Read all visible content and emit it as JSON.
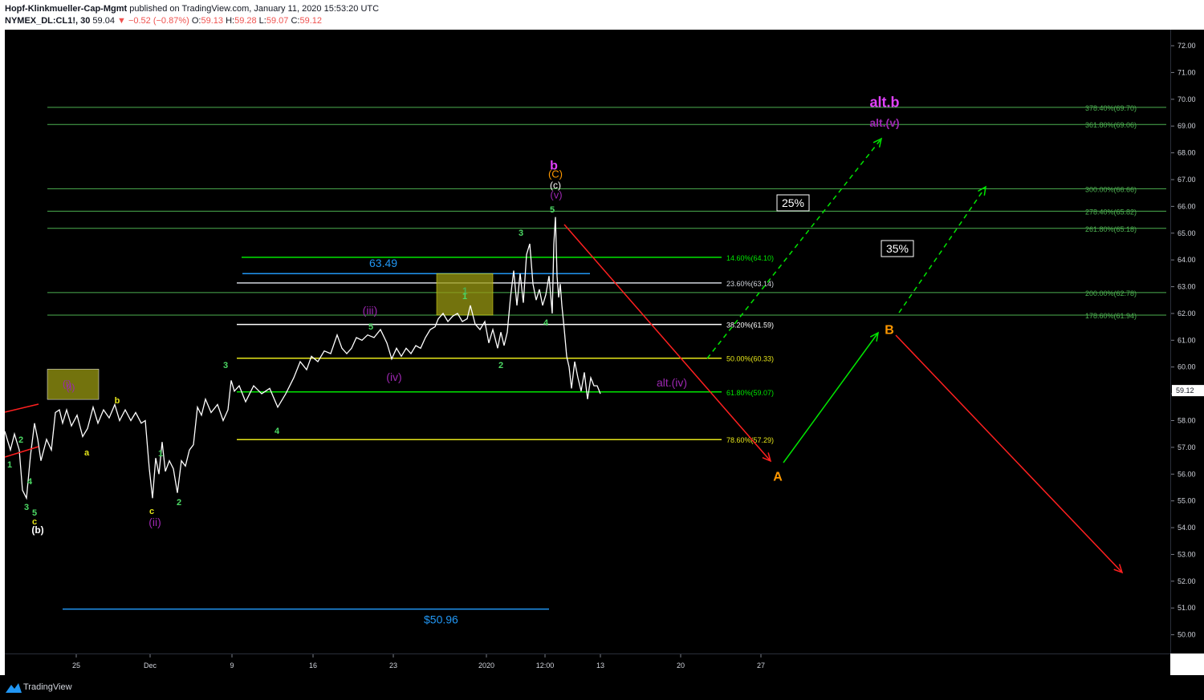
{
  "header": {
    "author": "Hopf-Klinkmueller-Cap-Mgmt",
    "published": "published on TradingView.com, January 11, 2020 15:53:20 UTC",
    "symbol": "NYMEX_DL:CL1!, 30",
    "last": "59.04",
    "change": "▼ −0.52 (−0.87%)",
    "o_label": "O:",
    "o": "59.13",
    "h_label": "H:",
    "h": "59.28",
    "l_label": "L:",
    "l": "59.07",
    "c_label": "C:",
    "c": "59.12"
  },
  "footer": {
    "brand": "TradingView"
  },
  "colors": {
    "up": "#00e600",
    "down": "#ef5350",
    "fib_green": "#4caf50",
    "yellow": "#e5e51a",
    "magenta": "#e040fb",
    "purple": "#9c27b0",
    "orange": "#ff9800",
    "blue": "#2196f3"
  },
  "chart_data": {
    "type": "line",
    "ylim": [
      49.3,
      72.6
    ],
    "price_ticks": [
      "72.00",
      "71.00",
      "70.00",
      "69.00",
      "68.00",
      "67.00",
      "66.00",
      "65.00",
      "64.00",
      "63.00",
      "62.00",
      "61.00",
      "60.00",
      "59.00",
      "58.00",
      "57.00",
      "56.00",
      "55.00",
      "54.00",
      "53.00",
      "52.00",
      "51.00",
      "50.00"
    ],
    "time_ticks": [
      "25",
      "Dec",
      "9",
      "16",
      "23",
      "2020",
      "12:00",
      "13",
      "20",
      "27"
    ],
    "current_price": "59.12",
    "price_series": {
      "name": "CL1!",
      "x": [
        0,
        7,
        12,
        18,
        22,
        27,
        32,
        37,
        41,
        45,
        52,
        58,
        63,
        68,
        72,
        77,
        83,
        90,
        97,
        103,
        110,
        116,
        123,
        130,
        137,
        143,
        150,
        157,
        163,
        170,
        175,
        180,
        184,
        188,
        192,
        196,
        200,
        205,
        210,
        215,
        220,
        225,
        230,
        235,
        240,
        245,
        250,
        257,
        265,
        272,
        278,
        282,
        286,
        292,
        300,
        310,
        320,
        330,
        340,
        350,
        360,
        368,
        376,
        382,
        390,
        398,
        406,
        414,
        420,
        426,
        432,
        438,
        445,
        452,
        460,
        468,
        476,
        482,
        488,
        494,
        500,
        506,
        512,
        518,
        524,
        530,
        536,
        540,
        546,
        552,
        558,
        564,
        570,
        576,
        580,
        586,
        592,
        598,
        603,
        608,
        614,
        618,
        622,
        626,
        630,
        634,
        638,
        642,
        646,
        650,
        654,
        658,
        662,
        666,
        670,
        674,
        678,
        682,
        684,
        686,
        688,
        690,
        692,
        694,
        697,
        700,
        703,
        706,
        710,
        714,
        718,
        722,
        726,
        730,
        734,
        738,
        742
      ],
      "y": [
        57.6,
        56.9,
        57.5,
        56.9,
        55.4,
        55.1,
        56.7,
        57.9,
        57.3,
        56.5,
        57.3,
        56.9,
        58.3,
        58.4,
        57.9,
        58.4,
        57.8,
        58.2,
        57.4,
        57.7,
        58.5,
        57.9,
        58.4,
        58.1,
        58.6,
        58.0,
        58.4,
        58.0,
        58.3,
        57.9,
        58.0,
        56.2,
        55.1,
        56.6,
        56.0,
        57.2,
        56.1,
        56.5,
        56.2,
        55.3,
        56.5,
        56.3,
        56.9,
        57.1,
        58.5,
        58.2,
        58.8,
        58.3,
        58.6,
        58.0,
        58.4,
        59.5,
        59.1,
        59.3,
        58.7,
        59.3,
        59.0,
        59.2,
        58.5,
        59.0,
        59.6,
        60.2,
        59.9,
        60.4,
        60.2,
        60.6,
        60.5,
        61.2,
        60.7,
        60.5,
        60.7,
        61.1,
        61.0,
        61.2,
        61.1,
        61.4,
        60.9,
        60.3,
        60.7,
        60.4,
        60.7,
        60.5,
        60.8,
        60.7,
        61.1,
        61.4,
        61.5,
        61.8,
        62.0,
        61.7,
        61.9,
        62.0,
        61.7,
        61.8,
        62.3,
        61.6,
        61.4,
        61.7,
        60.9,
        61.4,
        60.7,
        61.3,
        60.8,
        61.3,
        62.6,
        63.6,
        62.3,
        63.5,
        62.4,
        64.2,
        64.6,
        63.1,
        62.5,
        62.9,
        62.3,
        62.7,
        63.4,
        62.0,
        64.6,
        65.6,
        63.4,
        62.6,
        63.1,
        62.3,
        61.4,
        60.4,
        60.0,
        59.2,
        60.2,
        59.6,
        59.1,
        59.8,
        58.8,
        59.6,
        59.3,
        59.3,
        59.0
      ]
    },
    "fib_levels": [
      {
        "label": "378.40%(69.70)",
        "value": 69.7
      },
      {
        "label": "361.80%(69.06)",
        "value": 69.06
      },
      {
        "label": "300.00%(66.66)",
        "value": 66.66
      },
      {
        "label": "278.40%(65.82)",
        "value": 65.82
      },
      {
        "label": "261.80%(65.18)",
        "value": 65.18
      },
      {
        "label": "200.00%(62.78)",
        "value": 62.78
      },
      {
        "label": "178.60%(61.94)",
        "value": 61.94
      }
    ],
    "retrace_levels": [
      {
        "label": "14.60%(64.10)",
        "value": 64.1
      },
      {
        "label": "23.60%(63.14)",
        "value": 63.14
      },
      {
        "label": "38.20%(61.59)",
        "value": 61.59
      },
      {
        "label": "50.00%(60.33)",
        "value": 60.33
      },
      {
        "label": "61.80%(59.07)",
        "value": 59.07
      },
      {
        "label": "78.60%(57.29)",
        "value": 57.29
      }
    ],
    "hlines": [
      {
        "label": "63.49",
        "value": 63.49
      },
      {
        "label": "$50.96",
        "value": 50.96
      }
    ],
    "boxes": [
      {
        "label": "1",
        "price_high": 63.49,
        "price_low": 61.94
      },
      {
        "label": "(i)",
        "price_high": 59.92,
        "price_low": 58.79
      }
    ],
    "percent_labels": [
      "25%",
      "35%"
    ],
    "wave_labels": [
      "b",
      "(C)",
      "(c)",
      "(v)",
      "5",
      "3",
      "4",
      "1",
      "2",
      "5",
      "(iii)",
      "(iv)",
      "alt.(iv)",
      "3",
      "4",
      "1",
      "2",
      "c",
      "(ii)",
      "b",
      "a",
      "(i)",
      "1",
      "2",
      "4",
      "3",
      "5",
      "c",
      "(b)",
      "A",
      "B",
      "alt.b",
      "alt.(v)"
    ]
  }
}
